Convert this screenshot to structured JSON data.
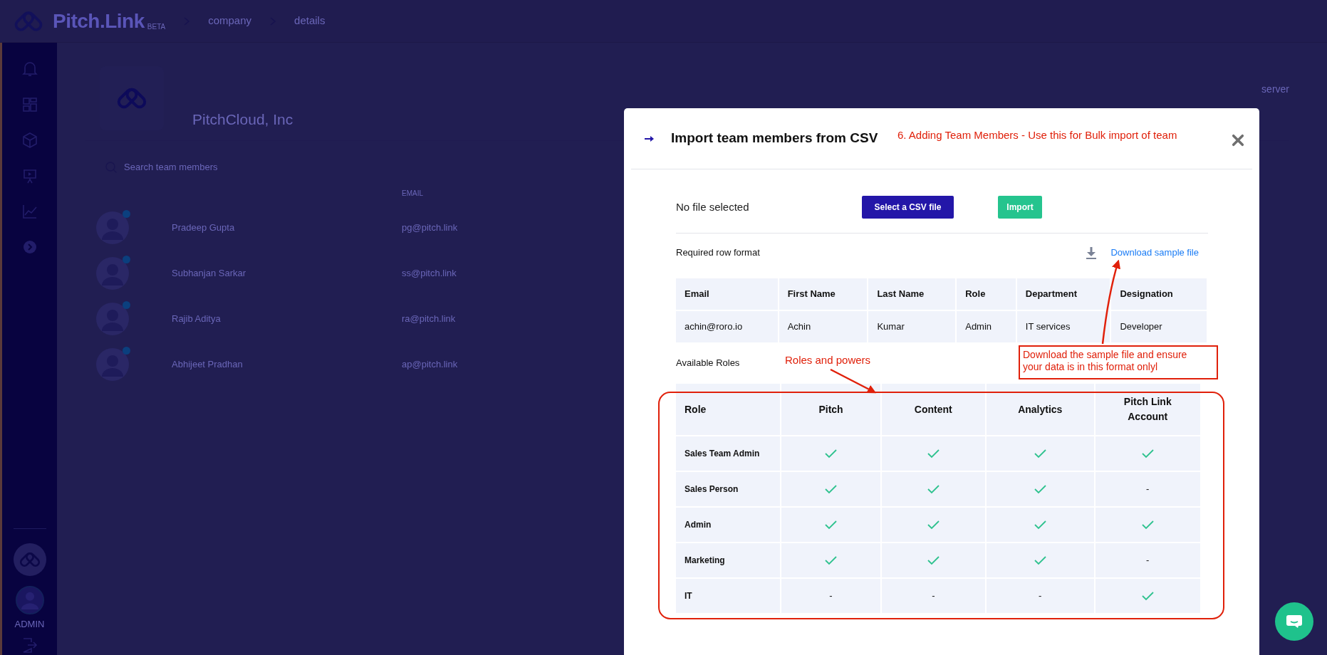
{
  "header": {
    "brand": "Pitch.Link",
    "badge": "BETA",
    "breadcrumbs": [
      "company",
      "details"
    ]
  },
  "sidebar": {
    "user_label": "ADMIN"
  },
  "company": {
    "name": "PitchCloud, Inc",
    "side_text": "server"
  },
  "search": {
    "placeholder": "Search team members"
  },
  "members": {
    "columns": [
      "EMAIL"
    ],
    "rows": [
      {
        "name": "Pradeep Gupta",
        "email": "pg@pitch.link"
      },
      {
        "name": "Subhanjan Sarkar",
        "email": "ss@pitch.link"
      },
      {
        "name": "Rajib Aditya",
        "email": "ra@pitch.link"
      },
      {
        "name": "Abhijeet Pradhan",
        "email": "ap@pitch.link"
      }
    ]
  },
  "modal": {
    "title": "Import team members from CSV",
    "file_status": "No file selected",
    "buttons": [
      {
        "label": "Select a CSV file",
        "kind": "primary"
      },
      {
        "label": "Import",
        "kind": "success"
      }
    ],
    "format_label": "Required row format",
    "download_link": "Download sample file",
    "format_table": {
      "columns": [
        "Email",
        "First Name",
        "Last Name",
        "Role",
        "Department",
        "Designation"
      ],
      "rows": [
        [
          "achin@roro.io",
          "Achin",
          "Kumar",
          "Admin",
          "IT services",
          "Developer"
        ]
      ]
    },
    "roles_label": "Available Roles",
    "roles_table": {
      "columns": [
        "Role",
        "Pitch",
        "Content",
        "Analytics",
        "Pitch Link Account"
      ],
      "rows": [
        {
          "cells": [
            {
              "kind": "role",
              "text": "Sales Team Admin"
            },
            {
              "kind": "check"
            },
            {
              "kind": "check"
            },
            {
              "kind": "check"
            },
            {
              "kind": "check"
            }
          ]
        },
        {
          "cells": [
            {
              "kind": "role",
              "text": "Sales Person"
            },
            {
              "kind": "check"
            },
            {
              "kind": "check"
            },
            {
              "kind": "check"
            },
            {
              "kind": "dash",
              "text": "-"
            }
          ]
        },
        {
          "cells": [
            {
              "kind": "role",
              "text": "Admin"
            },
            {
              "kind": "check"
            },
            {
              "kind": "check"
            },
            {
              "kind": "check"
            },
            {
              "kind": "check"
            }
          ]
        },
        {
          "cells": [
            {
              "kind": "role",
              "text": "Marketing"
            },
            {
              "kind": "check"
            },
            {
              "kind": "check"
            },
            {
              "kind": "check"
            },
            {
              "kind": "dash",
              "text": "-"
            }
          ]
        },
        {
          "cells": [
            {
              "kind": "role",
              "text": "IT"
            },
            {
              "kind": "dash",
              "text": "-"
            },
            {
              "kind": "dash",
              "text": "-"
            },
            {
              "kind": "dash",
              "text": "-"
            },
            {
              "kind": "check"
            }
          ]
        }
      ]
    }
  },
  "annotations": {
    "title_note": "6. Adding Team Members - Use this for Bulk import of team",
    "callout": "Download the sample file and ensure your data is in this format onlyl",
    "roles_note": "Roles and powers"
  }
}
